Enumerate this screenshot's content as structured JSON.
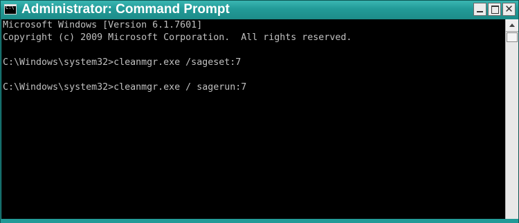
{
  "window": {
    "title": "Administrator: Command Prompt",
    "icon_text": "C:\\",
    "controls": {
      "minimize": "",
      "maximize": "",
      "close": "✕"
    }
  },
  "console": {
    "lines": [
      "Microsoft Windows [Version 6.1.7601]",
      "Copyright (c) 2009 Microsoft Corporation.  All rights reserved.",
      "",
      "C:\\Windows\\system32>cleanmgr.exe /sageset:7",
      "",
      "C:\\Windows\\system32>cleanmgr.exe / sagerun:7"
    ]
  },
  "colors": {
    "titlebar": "#229a97",
    "console_bg": "#000000",
    "console_text": "#c0c0c0"
  }
}
